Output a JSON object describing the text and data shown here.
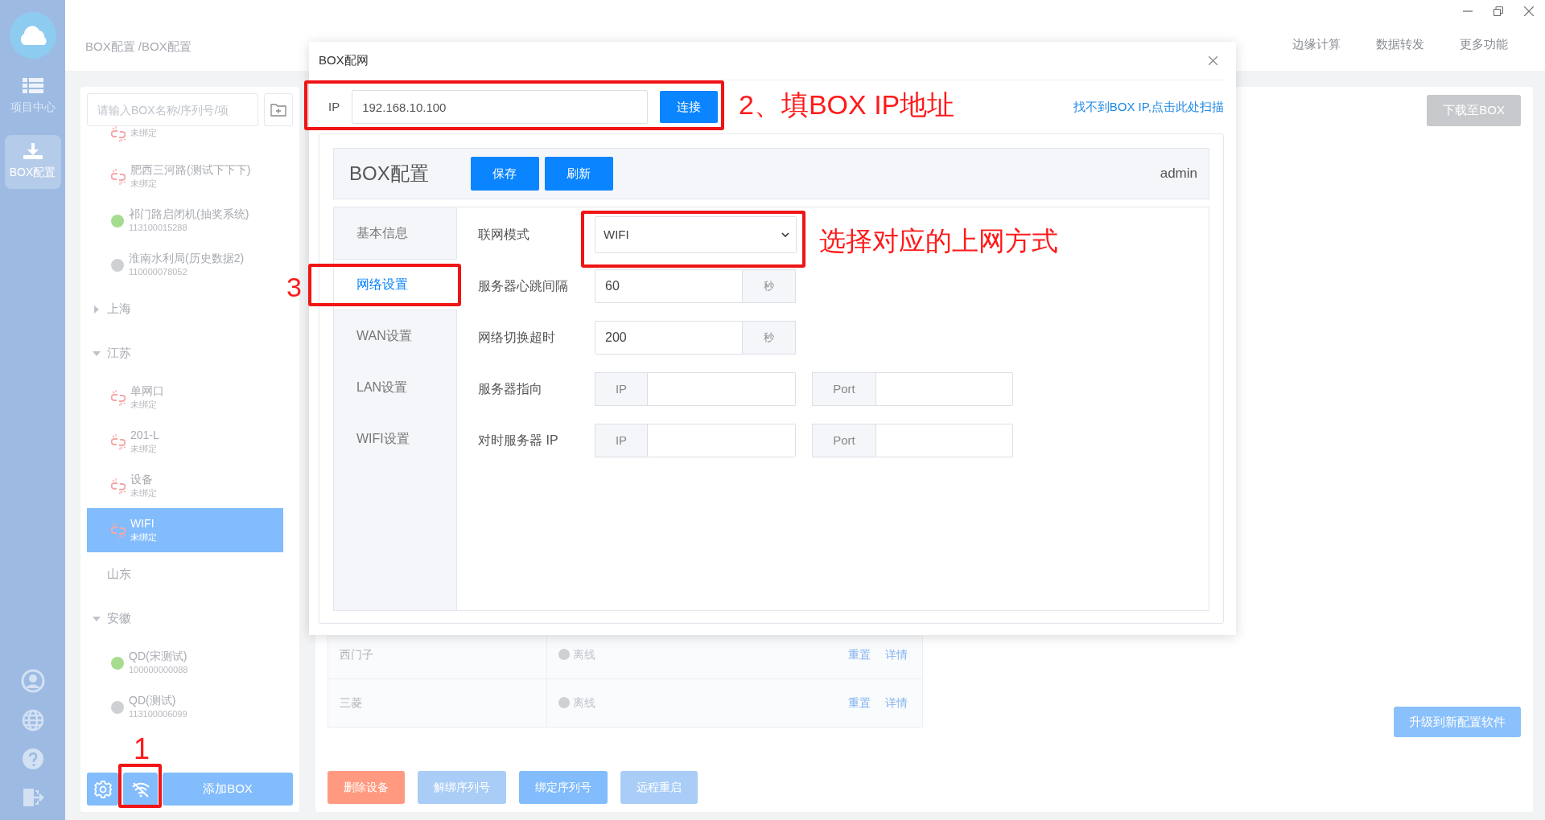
{
  "rail": {
    "items": [
      {
        "label": "项目中心",
        "kind": "list",
        "selected": false
      },
      {
        "label": "BOX配置",
        "kind": "download",
        "selected": true
      }
    ]
  },
  "breadcrumb": "BOX配置 /BOX配置",
  "top_nav": [
    "边缘计算",
    "数据转发",
    "更多功能"
  ],
  "tree": {
    "search_placeholder": "请输入BOX名称/序列号/项",
    "add_button": "添加BOX",
    "nodes": [
      {
        "kind": "unbound",
        "sub": "未绑定",
        "selected": false
      },
      {
        "kind": "unbound",
        "name": "肥西三河路(测试下下下)",
        "sub": "未绑定",
        "selected": false
      },
      {
        "kind": "online",
        "name": "祁门路启闭机(抽奖系统)",
        "sub": "113100015288",
        "selected": false
      },
      {
        "kind": "offline",
        "name": "淮南水利局(历史数据2)",
        "sub": "110000078052",
        "selected": false
      },
      {
        "kind": "group",
        "name": "上海",
        "expanded": false
      },
      {
        "kind": "group",
        "name": "江苏",
        "expanded": true,
        "children": [
          {
            "kind": "unbound",
            "name": "单网口",
            "sub": "未绑定",
            "selected": false
          },
          {
            "kind": "unbound",
            "name": "201-L",
            "sub": "未绑定",
            "selected": false
          },
          {
            "kind": "unbound",
            "name": "设备",
            "sub": "未绑定",
            "selected": false
          },
          {
            "kind": "unbound",
            "name": "WIFI",
            "sub": "未绑定",
            "selected": true
          }
        ]
      },
      {
        "kind": "group",
        "name": "山东"
      },
      {
        "kind": "group",
        "name": "安徽",
        "expanded": true,
        "children": [
          {
            "kind": "online",
            "name": "QD(宋测试)",
            "sub": "100000000088",
            "selected": false
          },
          {
            "kind": "offline",
            "name": "QD(测试)",
            "sub": "113100006099",
            "selected": false
          }
        ]
      }
    ]
  },
  "download_button": "下载至BOX",
  "devices_table": {
    "rows": [
      {
        "name": "西门子",
        "status": "离线",
        "actions": [
          "重置",
          "详情"
        ]
      },
      {
        "name": "三菱",
        "status": "离线",
        "actions": [
          "重置",
          "详情"
        ]
      }
    ]
  },
  "upgrade_button": "升级到新配置软件",
  "bottom_buttons": [
    {
      "label": "删除设备",
      "kind": "danger",
      "disabled": false
    },
    {
      "label": "解绑序列号",
      "kind": "primary",
      "disabled": true
    },
    {
      "label": "绑定序列号",
      "kind": "primary",
      "disabled": false
    },
    {
      "label": "远程重启",
      "kind": "primary",
      "disabled": true
    }
  ],
  "dialog": {
    "title": "BOX配网",
    "ip_label": "IP",
    "ip_value": "192.168.10.100",
    "connect_button": "连接",
    "scan_link": "找不到BOX IP,点击此处扫描",
    "config": {
      "title": "BOX配置",
      "buttons": [
        "保存",
        "刷新"
      ],
      "user": "admin",
      "tabs": [
        {
          "label": "基本信息",
          "selected": false
        },
        {
          "label": "网络设置",
          "selected": true
        },
        {
          "label": "WAN设置",
          "selected": false
        },
        {
          "label": "LAN设置",
          "selected": false
        },
        {
          "label": "WIFI设置",
          "selected": false
        }
      ],
      "rows": [
        {
          "kind": "select",
          "label": "联网模式",
          "value": "WIFI"
        },
        {
          "kind": "unit",
          "label": "服务器心跳间隔",
          "value": "60",
          "unit": "秒"
        },
        {
          "kind": "unit",
          "label": "网络切换超时",
          "value": "200",
          "unit": "秒"
        },
        {
          "kind": "address",
          "label": "服务器指向",
          "ip_addon": "IP",
          "port_addon": "Port"
        },
        {
          "kind": "address",
          "label": "对时服务器 IP",
          "ip_addon": "IP",
          "port_addon": "Port"
        }
      ]
    }
  },
  "annotations": [
    {
      "kind": "button",
      "text": "1"
    },
    {
      "kind": "field",
      "text": "2、填BOX IP地址"
    },
    {
      "kind": "tab",
      "text": "3"
    },
    {
      "kind": "select",
      "text": "选择对应的上网方式"
    }
  ]
}
